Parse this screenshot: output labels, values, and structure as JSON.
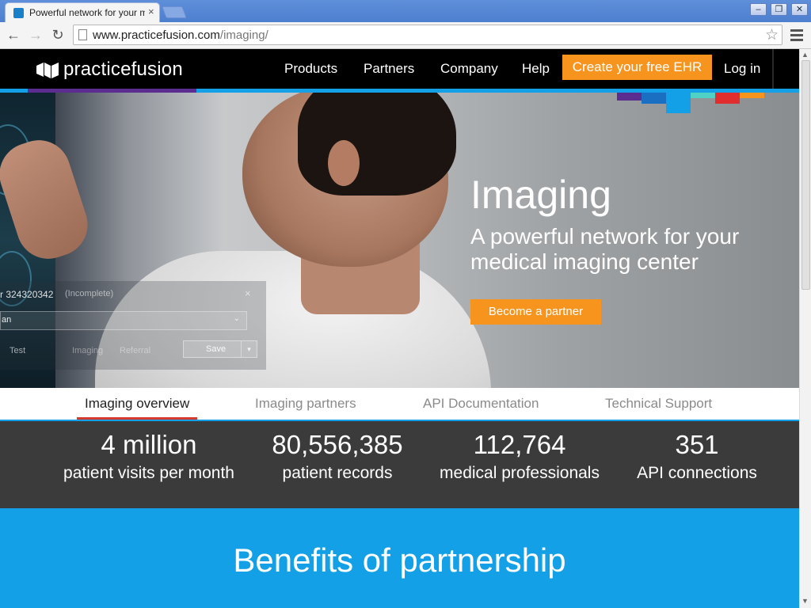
{
  "browser": {
    "tab_title": "Powerful network for your medical imaging center",
    "tab_close": "×",
    "url_host": "www.practicefusion.com",
    "url_path": "/imaging/",
    "window_buttons": {
      "minimize": "–",
      "restore": "❐",
      "close": "✕"
    },
    "nav": {
      "back": "←",
      "forward": "→",
      "reload": "↻",
      "star": "☆"
    }
  },
  "site": {
    "logo_text": "practicefusion",
    "nav_links": [
      "Products",
      "Partners",
      "Company",
      "Help"
    ],
    "cta_label": "Create your free EHR",
    "login_label": "Log in"
  },
  "hero": {
    "title": "Imaging",
    "subtitle": "A powerful network for your medical imaging center",
    "button_label": "Become a partner",
    "overlay": {
      "patient": "r 324320342",
      "status": "(Incomplete)",
      "close": "×",
      "select_value": "an",
      "tab_test": "Test",
      "tab_imaging": "Imaging",
      "tab_referral": "Referral",
      "save": "Save",
      "caret": "▾"
    }
  },
  "tabs": [
    "Imaging overview",
    "Imaging partners",
    "API Documentation",
    "Technical Support"
  ],
  "active_tab": "Imaging overview",
  "stats": [
    {
      "number": "4 million",
      "label": "patient visits per month"
    },
    {
      "number": "80,556,385",
      "label": "patient records"
    },
    {
      "number": "112,764",
      "label": "medical professionals"
    },
    {
      "number": "351",
      "label": "API connections"
    }
  ],
  "benefits": {
    "title": "Benefits of partnership"
  },
  "colors": {
    "orange": "#f7941e",
    "blue": "#14a0e6",
    "purple": "#5c2d91",
    "dark_blue": "#1a6fc2",
    "teal": "#4fd1c5",
    "red": "#e12d2d",
    "active_tab_underline": "#d63a2f",
    "stats_bg": "#3b3b3b"
  }
}
